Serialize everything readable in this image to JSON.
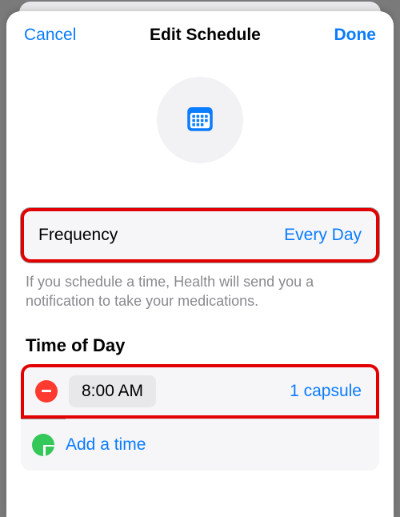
{
  "nav": {
    "cancel": "Cancel",
    "title": "Edit Schedule",
    "done": "Done"
  },
  "frequency": {
    "label": "Frequency",
    "value": "Every Day"
  },
  "hint": "If you schedule a time, Health will send you a notification to take your medications.",
  "timeOfDay": {
    "header": "Time of Day",
    "entries": [
      {
        "time": "8:00 AM",
        "dose": "1 capsule"
      }
    ],
    "addLabel": "Add a time"
  },
  "icons": {
    "schedule": "calendar-icon",
    "remove": "minus-circle-icon",
    "add": "plus-circle-icon"
  }
}
